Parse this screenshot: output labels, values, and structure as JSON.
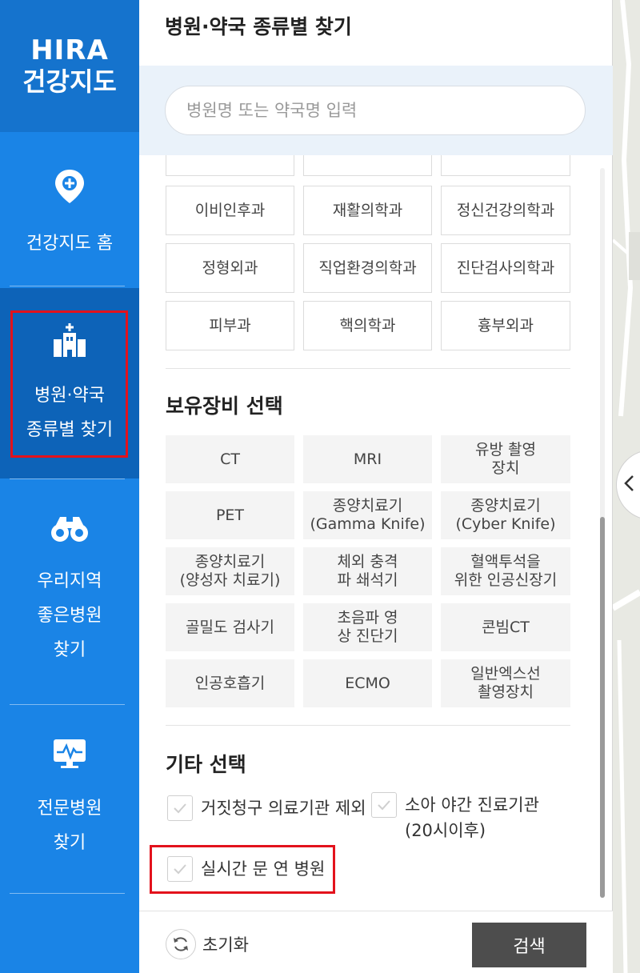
{
  "nav": {
    "logo_line1": "HIRA",
    "logo_line2": "건강지도",
    "items": [
      {
        "label": "건강지도 홈",
        "icon": "map-pin-plus-icon"
      },
      {
        "label1": "병원·약국",
        "label2": "종류별 찾기",
        "icon": "hospital-building-icon",
        "active": true
      },
      {
        "label1": "우리지역",
        "label2": "좋은병원",
        "label3": "찾기",
        "icon": "binoculars-icon"
      },
      {
        "label1": "전문병원",
        "label2": "찾기",
        "icon": "monitor-pulse-icon"
      }
    ]
  },
  "panel": {
    "title": "병원·약국 종류별 찾기",
    "search_placeholder": "병원명 또는 약국명 입력"
  },
  "specialties": [
    "이비인후과",
    "재활의학과",
    "정신건강의학과",
    "정형외과",
    "직업환경의학과",
    "진단검사의학과",
    "피부과",
    "핵의학과",
    "흉부외과"
  ],
  "equipment": {
    "title": "보유장비 선택",
    "items": [
      {
        "l1": "CT",
        "l2": ""
      },
      {
        "l1": "MRI",
        "l2": ""
      },
      {
        "l1": "유방 촬영",
        "l2": "장치"
      },
      {
        "l1": "PET",
        "l2": ""
      },
      {
        "l1": "종양치료기",
        "l2": "(Gamma Knife)"
      },
      {
        "l1": "종양치료기",
        "l2": "(Cyber Knife)"
      },
      {
        "l1": "종양치료기",
        "l2": "(양성자 치료기)"
      },
      {
        "l1": "체외 충격",
        "l2": "파 쇄석기"
      },
      {
        "l1": "혈액투석을",
        "l2": "위한 인공신장기"
      },
      {
        "l1": "골밀도 검사기",
        "l2": ""
      },
      {
        "l1": "초음파 영",
        "l2": "상 진단기"
      },
      {
        "l1": "콘빔CT",
        "l2": ""
      },
      {
        "l1": "인공호흡기",
        "l2": ""
      },
      {
        "l1": "ECMO",
        "l2": ""
      },
      {
        "l1": "일반엑스선",
        "l2": "촬영장치"
      }
    ]
  },
  "other": {
    "title": "기타 선택",
    "options": {
      "false_claim": "거짓청구 의료기관 제외",
      "pediatric_l1": "소아 야간 진료기관",
      "pediatric_l2": "(20시이후)",
      "open_now": "실시간 문 연 병원"
    }
  },
  "footer": {
    "reset_label": "초기화",
    "search_label": "검색"
  },
  "colors": {
    "nav_bg": "#1a84e6",
    "nav_active": "#0d63b8",
    "highlight": "#e3121c",
    "button_dark": "#4d4d4d"
  }
}
